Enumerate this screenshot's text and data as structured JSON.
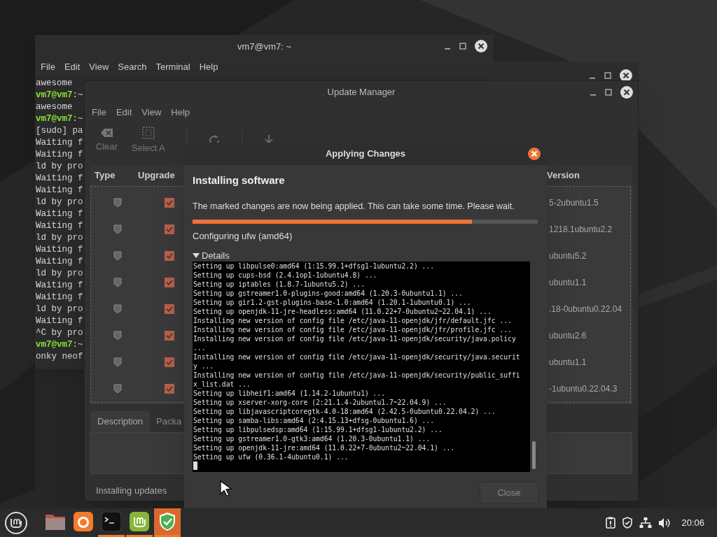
{
  "terminal_window": {
    "title": "vm7@vm7: ~",
    "menu": [
      "File",
      "Edit",
      "View",
      "Search",
      "Terminal",
      "Help"
    ],
    "lines": [
      {
        "kind": "output",
        "text": "awesome"
      },
      {
        "kind": "prompt",
        "user": "vm7@vm7",
        "text": ":~"
      },
      {
        "kind": "output",
        "text": "awesome"
      },
      {
        "kind": "prompt",
        "user": "vm7@vm7",
        "text": ":~"
      },
      {
        "kind": "output",
        "text": "[sudo] pa"
      },
      {
        "kind": "output",
        "text": "Waiting f"
      },
      {
        "kind": "output",
        "text": "Waiting f"
      },
      {
        "kind": "output",
        "text": "ld by pro"
      },
      {
        "kind": "output",
        "text": "Waiting f"
      },
      {
        "kind": "output",
        "text": "Waiting f"
      },
      {
        "kind": "output",
        "text": "ld by pro"
      },
      {
        "kind": "output",
        "text": "Waiting f"
      },
      {
        "kind": "output",
        "text": "Waiting f"
      },
      {
        "kind": "output",
        "text": "ld by pro"
      },
      {
        "kind": "output",
        "text": "Waiting f"
      },
      {
        "kind": "output",
        "text": "Waiting f"
      },
      {
        "kind": "output",
        "text": "ld by pro"
      },
      {
        "kind": "output",
        "text": "Waiting f"
      },
      {
        "kind": "output",
        "text": "Waiting f"
      },
      {
        "kind": "output",
        "text": "ld by pro"
      },
      {
        "kind": "output",
        "text": "Waiting f"
      },
      {
        "kind": "output",
        "text": "^C by pro"
      },
      {
        "kind": "prompt",
        "user": "vm7@vm7",
        "text": ":~"
      },
      {
        "kind": "output",
        "text": "onky neof"
      }
    ]
  },
  "update_manager": {
    "title": "Update Manager",
    "menu": [
      "File",
      "Edit",
      "View",
      "Help"
    ],
    "toolbar": [
      {
        "kind": "clear",
        "label": "Clear"
      },
      {
        "kind": "select_all",
        "label": "Select A"
      },
      {
        "kind": "refresh"
      },
      {
        "kind": "install"
      }
    ],
    "columns": [
      "Type",
      "Upgrade",
      "Version"
    ],
    "rows": [
      {
        "upgrade": true,
        "version": "5-2ubuntu1.5"
      },
      {
        "upgrade": true,
        "version": "1218.1ubuntu2.2"
      },
      {
        "upgrade": true,
        "version": "ubuntu5.2"
      },
      {
        "upgrade": true,
        "version": "ubuntu1.1"
      },
      {
        "upgrade": true,
        "version": ".18-0ubuntu0.22.04"
      },
      {
        "upgrade": true,
        "version": "ubuntu2.6"
      },
      {
        "upgrade": true,
        "version": "ubuntu1.1"
      },
      {
        "upgrade": true,
        "version": "-1ubuntu0.22.04.3"
      }
    ],
    "tabs": [
      {
        "label": "Description",
        "selected": true
      },
      {
        "label": "Packa",
        "selected": false
      }
    ],
    "status": "Installing updates"
  },
  "dialog": {
    "title": "Applying Changes",
    "heading": "Installing software",
    "message": "The marked changes are now being applied. This can take some time. Please wait.",
    "level": 0.81,
    "task": "Configuring ufw (amd64)",
    "details": {
      "label": "Details",
      "expanded": true,
      "log": [
        "Setting up libpulse0:amd64 (1:15.99.1+dfsg1-1ubuntu2.2) ...",
        "Setting up cups-bsd (2.4.1op1-1ubuntu4.8) ...",
        "Setting up iptables (1.8.7-1ubuntu5.2) ...",
        "Setting up gstreamer1.0-plugins-good:amd64 (1.20.3-0ubuntu1.1) ...",
        "Setting up gir1.2-gst-plugins-base-1.0:amd64 (1.20.1-1ubuntu0.1) ...",
        "Setting up openjdk-11-jre-headless:amd64 (11.0.22+7-0ubuntu2~22.04.1) ...",
        "Installing new version of config file /etc/java-11-openjdk/jfr/default.jfc ...",
        "Installing new version of config file /etc/java-11-openjdk/jfr/profile.jfc ...",
        "Installing new version of config file /etc/java-11-openjdk/security/java.policy",
        "...",
        "Installing new version of config file /etc/java-11-openjdk/security/java.securit",
        "y ...",
        "Installing new version of config file /etc/java-11-openjdk/security/public_suffi",
        "x_list.dat ...",
        "Setting up libheif1:amd64 (1.14.2-1ubuntu1) ...",
        "Setting up xserver-xorg-core (2:21.1.4-2ubuntu1.7~22.04.9) ...",
        "Setting up libjavascriptcoregtk-4.0-18:amd64 (2.42.5-0ubuntu0.22.04.2) ...",
        "Setting up samba-libs:amd64 (2:4.15.13+dfsg-0ubuntu1.6) ...",
        "Setting up libpulsedsp:amd64 (1:15.99.1+dfsg1-1ubuntu2.2) ...",
        "Setting up gstreamer1.0-gtk3:amd64 (1.20.3-0ubuntu1.1) ...",
        "Setting up openjdk-11-jre:amd64 (11.0.22+7-0ubuntu2~22.04.1) ...",
        "Setting up ufw (0.36.1-4ubuntu0.1) ..."
      ]
    },
    "button": {
      "label": "Close",
      "disabled": true
    }
  },
  "taskbar": {
    "apps": [
      {
        "kind": "files",
        "running": false,
        "selected": false
      },
      {
        "kind": "browser",
        "running": false,
        "selected": false
      },
      {
        "kind": "terminal",
        "running": true,
        "selected": false
      },
      {
        "kind": "update_manager",
        "running": true,
        "selected": false
      },
      {
        "kind": "shield",
        "running": true,
        "selected": true
      }
    ],
    "clock": "20:06"
  }
}
